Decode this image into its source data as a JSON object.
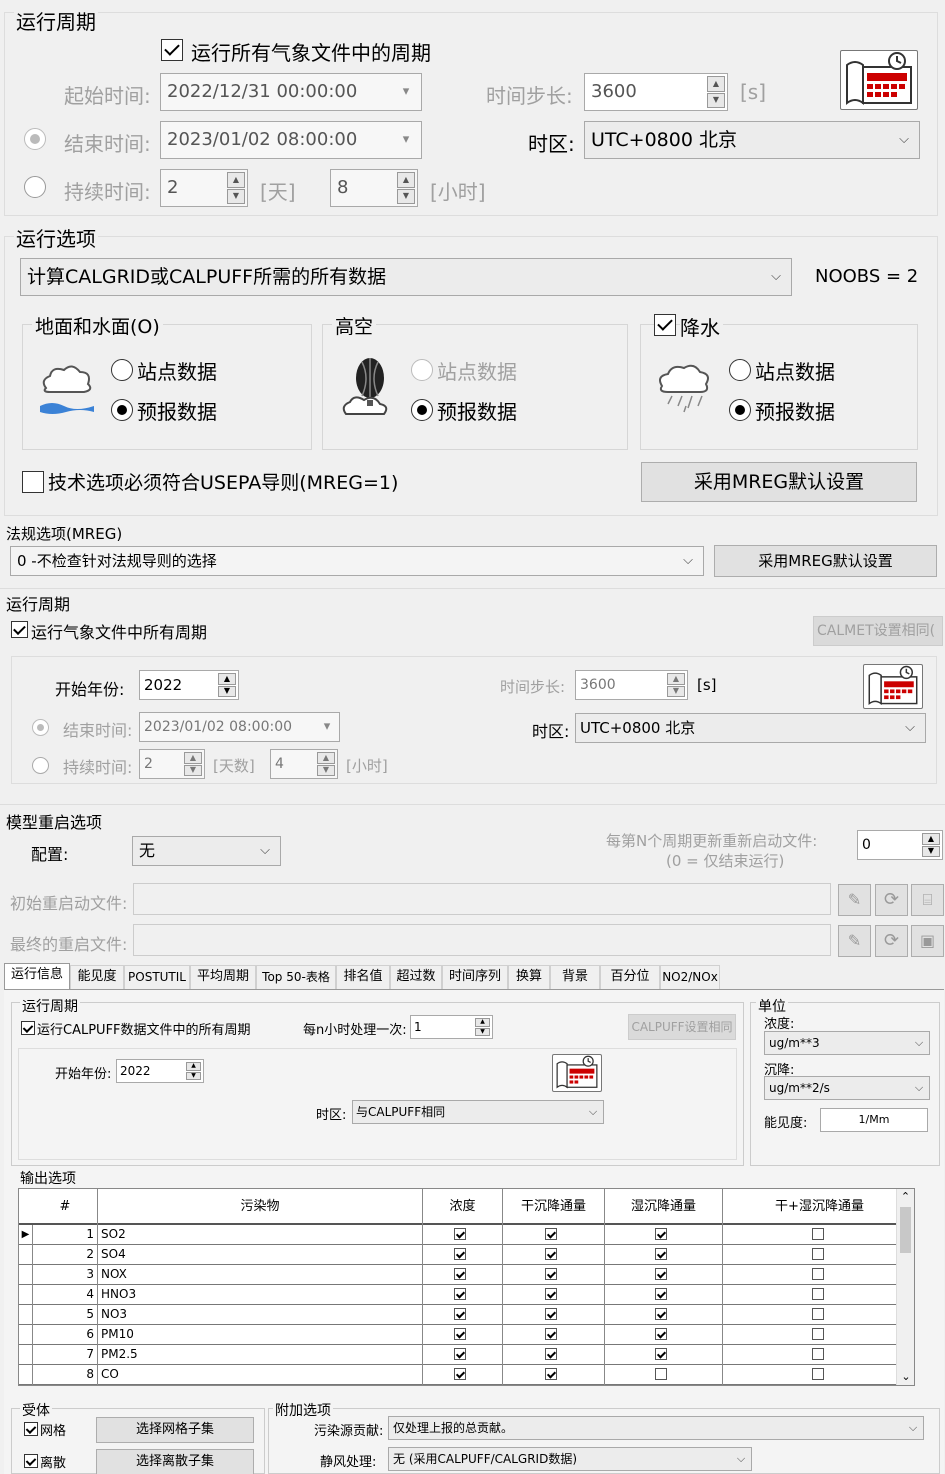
{
  "s1": {
    "title": "运行周期",
    "all_periods_label": "运行所有气象文件中的周期",
    "start_label": "起始时间:",
    "start_value": "2022/12/31 00:00:00",
    "end_label": "结束时间:",
    "end_value": "2023/01/02 08:00:00",
    "duration_label": "持续时间:",
    "duration_days": "2",
    "days_unit": "[天]",
    "duration_hours": "8",
    "hours_unit": "[小时]",
    "step_label": "时间步长:",
    "step_value": "3600",
    "step_unit": "[s]",
    "tz_label": "时区:",
    "tz_value": "UTC+0800 北京"
  },
  "s2": {
    "title": "运行选项",
    "mode_value": "计算CALGRID或CALPUFF所需的所有数据",
    "noobs": "NOOBS = 2",
    "surface_title": "地面和水面(O)",
    "upper_title": "高空",
    "precip_title": "降水",
    "station": "站点数据",
    "forecast": "预报数据",
    "mreg_check": "技术选项必须符合USEPA导则(MREG=1)",
    "mreg_button": "采用MREG默认设置"
  },
  "s3": {
    "title": "法规选项(MREG)",
    "value": "0 -不检查针对法规导则的选择",
    "button": "采用MREG默认设置"
  },
  "s4": {
    "title": "运行周期",
    "all_label": "运行气象文件中所有周期",
    "same_button": "CALMET设置相同(",
    "start_year_label": "开始年份:",
    "start_year": "2022",
    "end_label": "结束时间:",
    "end_value": "2023/01/02 08:00:00",
    "duration_label": "持续时间:",
    "duration_days": "2",
    "days_unit": "[天数]",
    "duration_hours": "4",
    "hours_unit": "[小时]",
    "step_label": "时间步长:",
    "step_value": "3600",
    "step_unit": "[s]",
    "tz_label": "时区:",
    "tz_value": "UTC+0800 北京"
  },
  "s5": {
    "title": "模型重启选项",
    "config_label": "配置:",
    "config_value": "无",
    "every_n_label": "每第N个周期更新重新启动文件:",
    "every_n_hint": "(0 = 仅结束运行)",
    "every_n_value": "0",
    "initial_label": "初始重启动文件:",
    "final_label": "最终的重启文件:"
  },
  "tabs": [
    {
      "label": "运行信息"
    },
    {
      "label": "能见度"
    },
    {
      "label": "POSTUTIL"
    },
    {
      "label": "平均周期"
    },
    {
      "label": "Top 50-表格"
    },
    {
      "label": "排名值"
    },
    {
      "label": "超过数"
    },
    {
      "label": "时间序列"
    },
    {
      "label": "换算"
    },
    {
      "label": "背景"
    },
    {
      "label": "百分位"
    },
    {
      "label": "NO2/NOx"
    }
  ],
  "s6": {
    "title": "运行周期",
    "all_label": "运行CALPUFF数据文件中的所有周期",
    "every_label": "每n小时处理一次:",
    "every_value": "1",
    "same_button": "CALPUFF设置相同",
    "start_year_label": "开始年份:",
    "start_year": "2022",
    "tz_label": "时区:",
    "tz_value": "与CALPUFF相同",
    "units_title": "单位",
    "conc_label": "浓度:",
    "conc_value": "ug/m**3",
    "dep_label": "沉降:",
    "dep_value": "ug/m**2/s",
    "vis_label": "能见度:",
    "vis_value": "1/Mm"
  },
  "output": {
    "title": "输出选项",
    "headers": [
      "#",
      "污染物",
      "浓度",
      "干沉降通量",
      "湿沉降通量",
      "干+湿沉降通量"
    ],
    "rows": [
      {
        "n": "1",
        "name": "SO2",
        "c": true,
        "d": true,
        "w": true,
        "dw": false
      },
      {
        "n": "2",
        "name": "SO4",
        "c": true,
        "d": true,
        "w": true,
        "dw": false
      },
      {
        "n": "3",
        "name": "NOX",
        "c": true,
        "d": true,
        "w": true,
        "dw": false
      },
      {
        "n": "4",
        "name": "HNO3",
        "c": true,
        "d": true,
        "w": true,
        "dw": false
      },
      {
        "n": "5",
        "name": "NO3",
        "c": true,
        "d": true,
        "w": true,
        "dw": false
      },
      {
        "n": "6",
        "name": "PM10",
        "c": true,
        "d": true,
        "w": true,
        "dw": false
      },
      {
        "n": "7",
        "name": "PM2.5",
        "c": true,
        "d": true,
        "w": true,
        "dw": false
      },
      {
        "n": "8",
        "name": "CO",
        "c": true,
        "d": true,
        "w": false,
        "dw": false
      }
    ]
  },
  "receptors": {
    "title": "受体",
    "grid_label": "网格",
    "grid_button": "选择网格子集",
    "discrete_label": "离散",
    "discrete_button": "选择离散子集"
  },
  "extra": {
    "title": "附加选项",
    "source_label": "污染源贡献:",
    "source_value": "仅处理上报的总贡献。",
    "calm_label": "静风处理:",
    "calm_value": "无 (采用CALPUFF/CALGRID数据)"
  }
}
